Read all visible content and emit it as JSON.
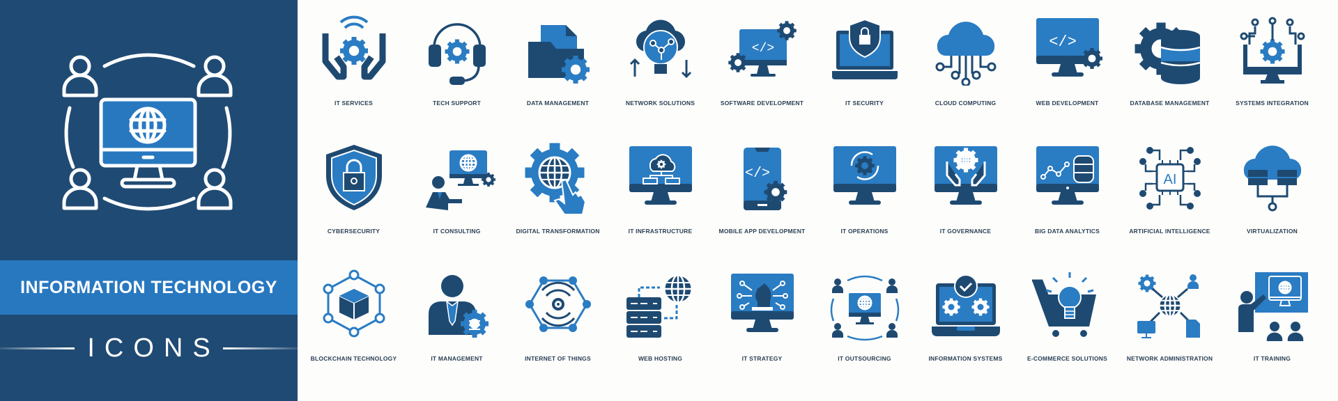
{
  "banner": {
    "title": "INFORMATION TECHNOLOGY",
    "subtitle": "ICONS",
    "hero_icon": "monitor-globe-people-icon"
  },
  "colors": {
    "navy": "#1f4a73",
    "blue": "#2878c0",
    "dark_icon": "#1e4a72",
    "light_icon": "#2a7cc3",
    "background": "#fdfdfb",
    "label": "#2a3f55"
  },
  "icons": [
    {
      "label": "IT SERVICES",
      "icon": "hands-gear-wifi-icon"
    },
    {
      "label": "TECH SUPPORT",
      "icon": "headset-gear-icon"
    },
    {
      "label": "DATA MANAGEMENT",
      "icon": "folder-gear-icon"
    },
    {
      "label": "NETWORK SOLUTIONS",
      "icon": "cloud-bulb-network-icon"
    },
    {
      "label": "SOFTWARE DEVELOPMENT",
      "icon": "monitor-code-gears-icon"
    },
    {
      "label": "IT SECURITY",
      "icon": "laptop-shield-lock-icon"
    },
    {
      "label": "CLOUD COMPUTING",
      "icon": "cloud-circuit-icon"
    },
    {
      "label": "WEB DEVELOPMENT",
      "icon": "monitor-code-gear-icon"
    },
    {
      "label": "DATABASE MANAGEMENT",
      "icon": "database-gear-icon"
    },
    {
      "label": "SYSTEMS INTEGRATION",
      "icon": "monitor-gear-circuit-icon"
    },
    {
      "label": "CYBERSECURITY",
      "icon": "shield-lock-icon"
    },
    {
      "label": "IT CONSULTING",
      "icon": "person-monitor-globe-icon"
    },
    {
      "label": "DIGITAL TRANSFORMATION",
      "icon": "gear-globe-hand-icon"
    },
    {
      "label": "IT INFRASTRUCTURE",
      "icon": "monitor-cloud-hierarchy-icon"
    },
    {
      "label": "MOBILE APP DEVELOPMENT",
      "icon": "phone-code-gear-icon"
    },
    {
      "label": "IT OPERATIONS",
      "icon": "monitor-gear-cycle-icon"
    },
    {
      "label": "IT GOVERNANCE",
      "icon": "monitor-hands-globe-icon"
    },
    {
      "label": "BIG DATA ANALYTICS",
      "icon": "monitor-chart-database-icon"
    },
    {
      "label": "ARTIFICIAL INTELLIGENCE",
      "icon": "ai-chip-icon"
    },
    {
      "label": "VIRTUALIZATION",
      "icon": "cloud-servers-icon"
    },
    {
      "label": "BLOCKCHAIN TECHNOLOGY",
      "icon": "cube-hexagon-nodes-icon"
    },
    {
      "label": "IT MANAGEMENT",
      "icon": "businessman-gear-icon"
    },
    {
      "label": "INTERNET OF THINGS",
      "icon": "hexagon-signal-icon"
    },
    {
      "label": "WEB HOSTING",
      "icon": "server-globe-icon"
    },
    {
      "label": "IT STRATEGY",
      "icon": "monitor-chess-knight-icon"
    },
    {
      "label": "IT OUTSOURCING",
      "icon": "monitor-globe-people-icon"
    },
    {
      "label": "INFORMATION SYSTEMS",
      "icon": "laptop-gears-check-icon"
    },
    {
      "label": "E-COMMERCE SOLUTIONS",
      "icon": "cart-bulb-icon"
    },
    {
      "label": "NETWORK ADMINISTRATION",
      "icon": "globe-network-nodes-icon"
    },
    {
      "label": "IT TRAINING",
      "icon": "presenter-board-audience-icon"
    }
  ]
}
